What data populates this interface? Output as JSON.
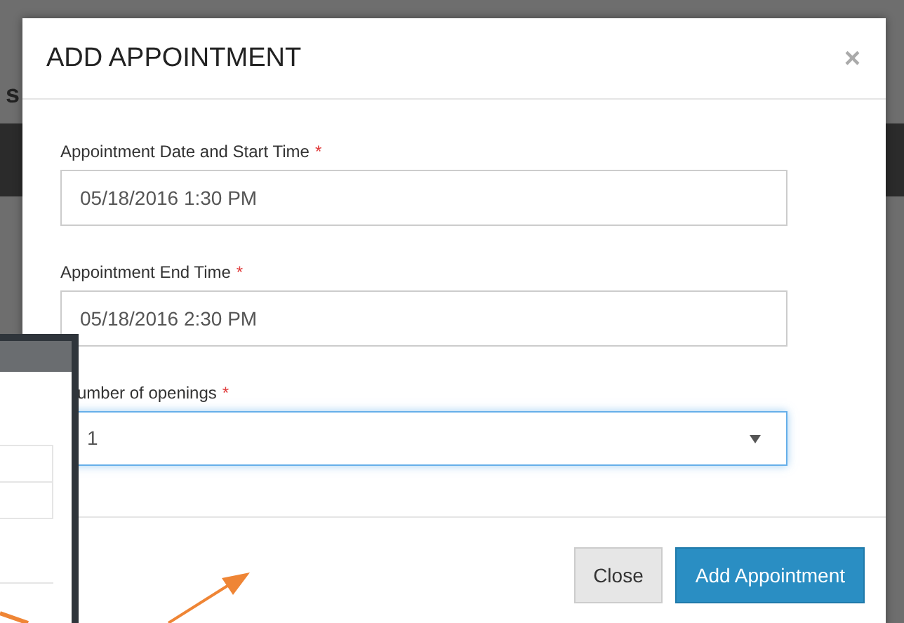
{
  "background_page": {
    "fragments": [
      "s"
    ]
  },
  "modal": {
    "title": "ADD APPOINTMENT",
    "close_symbol": "×",
    "fields": [
      {
        "kind": "text",
        "label": "Appointment Date and Start Time",
        "required_mark": "*",
        "value": "05/18/2016 1:30 PM",
        "focused": false
      },
      {
        "kind": "text",
        "label": "Appointment End Time",
        "required_mark": "*",
        "value": "05/18/2016 2:30 PM",
        "focused": false
      },
      {
        "kind": "select",
        "label": "umber of openings",
        "required_mark": "*",
        "value": "1",
        "focused": true
      }
    ],
    "buttons": [
      {
        "label": "Close",
        "kind": "default"
      },
      {
        "label": "Add Appointment",
        "kind": "primary"
      }
    ]
  },
  "overlay_window": {
    "kind": "panel"
  }
}
